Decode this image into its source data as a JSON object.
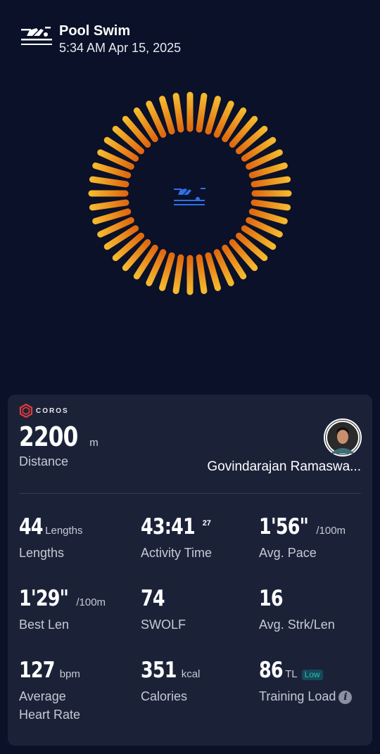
{
  "header": {
    "title": "Pool Swim",
    "datetime": "5:34 AM Apr 15, 2025",
    "icon": "swimmer-icon"
  },
  "ring": {
    "color_outer": "#f5b82e",
    "color_inner": "#e06a10",
    "center_icon_color": "#2f6fe8"
  },
  "card": {
    "brand": "COROS",
    "brand_color": "#e23b3b",
    "distance": {
      "value": "2200",
      "unit": "m",
      "label": "Distance"
    },
    "user_name": "Govindarajan Ramaswa...",
    "stats": [
      {
        "value": "44",
        "unit": "Lengths",
        "label": "Lengths"
      },
      {
        "value": "43:41",
        "sup": "27",
        "label": "Activity Time"
      },
      {
        "value": "1'56\"",
        "unit": "/100m",
        "label": "Avg. Pace"
      },
      {
        "value": "1'29\"",
        "unit": "/100m",
        "label": "Best Len"
      },
      {
        "value": "74",
        "label": "SWOLF"
      },
      {
        "value": "16",
        "label": "Avg. Strk/Len"
      },
      {
        "value": "127",
        "unit": "bpm",
        "label": "Average Heart Rate"
      },
      {
        "value": "351",
        "unit": "kcal",
        "label": "Calories"
      },
      {
        "value": "86",
        "unit": "TL",
        "badge": "Low",
        "label": "Training Load"
      }
    ]
  }
}
